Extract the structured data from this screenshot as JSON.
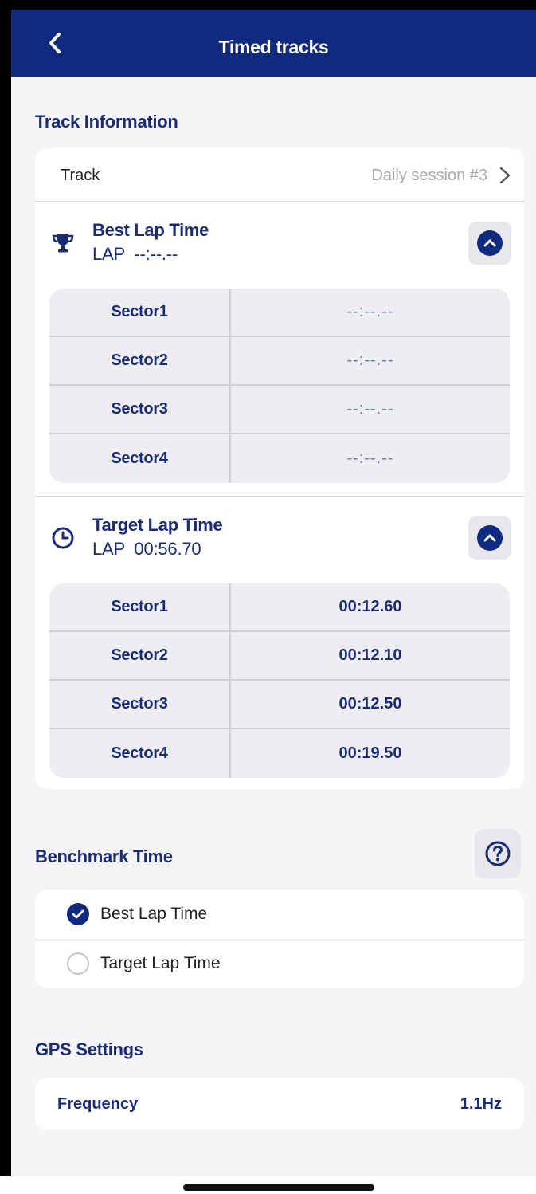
{
  "header": {
    "title": "Timed tracks"
  },
  "track_info": {
    "section_title": "Track Information",
    "track_label": "Track",
    "track_value": "Daily session #3",
    "best_lap": {
      "title": "Best Lap Time",
      "lap_text": "LAP  --:--.--",
      "sectors": [
        {
          "name": "Sector1",
          "time": "--:--.--"
        },
        {
          "name": "Sector2",
          "time": "--:--.--"
        },
        {
          "name": "Sector3",
          "time": "--:--.--"
        },
        {
          "name": "Sector4",
          "time": "--:--.--"
        }
      ]
    },
    "target_lap": {
      "title": "Target Lap Time",
      "lap_text": "LAP  00:56.70",
      "sectors": [
        {
          "name": "Sector1",
          "time": "00:12.60"
        },
        {
          "name": "Sector2",
          "time": "00:12.10"
        },
        {
          "name": "Sector3",
          "time": "00:12.50"
        },
        {
          "name": "Sector4",
          "time": "00:19.50"
        }
      ]
    }
  },
  "benchmark": {
    "section_title": "Benchmark Time",
    "options": [
      {
        "label": "Best Lap Time",
        "selected": true
      },
      {
        "label": "Target Lap Time",
        "selected": false
      }
    ]
  },
  "gps": {
    "section_title": "GPS Settings",
    "frequency_label": "Frequency",
    "frequency_value": "1.1Hz"
  },
  "colors": {
    "primary": "#0f2a7e",
    "text_navy": "#1a2c73",
    "background": "#f5f5f7"
  },
  "icons": [
    "back-chevron-icon",
    "chevron-right-icon",
    "trophy-icon",
    "clock-icon",
    "collapse-up-icon",
    "help-icon",
    "check-icon"
  ]
}
